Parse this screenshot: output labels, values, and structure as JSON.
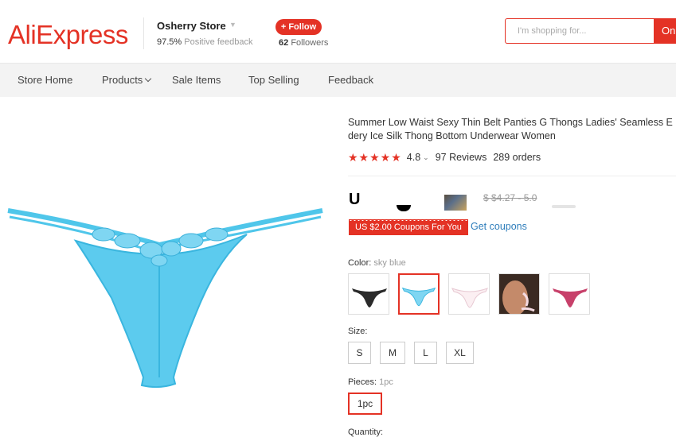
{
  "header": {
    "logo": "AliExpress",
    "store_name": "Osherry Store",
    "feedback_pct": "97.5%",
    "feedback_label": "Positive feedback",
    "follow_label": "+ Follow",
    "followers_count": "62",
    "followers_label": "Followers",
    "search_placeholder": "I'm shopping for...",
    "search_button": "On"
  },
  "nav": {
    "items": [
      {
        "label": "Store Home"
      },
      {
        "label": "Products"
      },
      {
        "label": "Sale Items"
      },
      {
        "label": "Top Selling"
      },
      {
        "label": "Feedback"
      }
    ]
  },
  "product": {
    "title_line1": "Summer Low Waist Sexy Thin Belt Panties G Thongs Ladies' Seamless E",
    "title_line2": "dery Ice Silk Thong Bottom Underwear Women",
    "rating": "4.8",
    "reviews": "97 Reviews",
    "orders": "289 orders",
    "price_prefix": "U",
    "original_price": "$ $4.27 - 5.0",
    "coupon": "US $2.00 Coupons For You",
    "get_coupons": "Get coupons",
    "color_label": "Color:",
    "color_value": "sky blue",
    "size_label": "Size:",
    "sizes": [
      "S",
      "M",
      "L",
      "XL"
    ],
    "pieces_label": "Pieces:",
    "pieces_value": "1pc",
    "pieces_option": "1pc",
    "quantity_label": "Quantity:"
  },
  "colors": {
    "brand": "#e43225",
    "link": "#2e7dbb",
    "product_blue": "#4fc6ea"
  }
}
